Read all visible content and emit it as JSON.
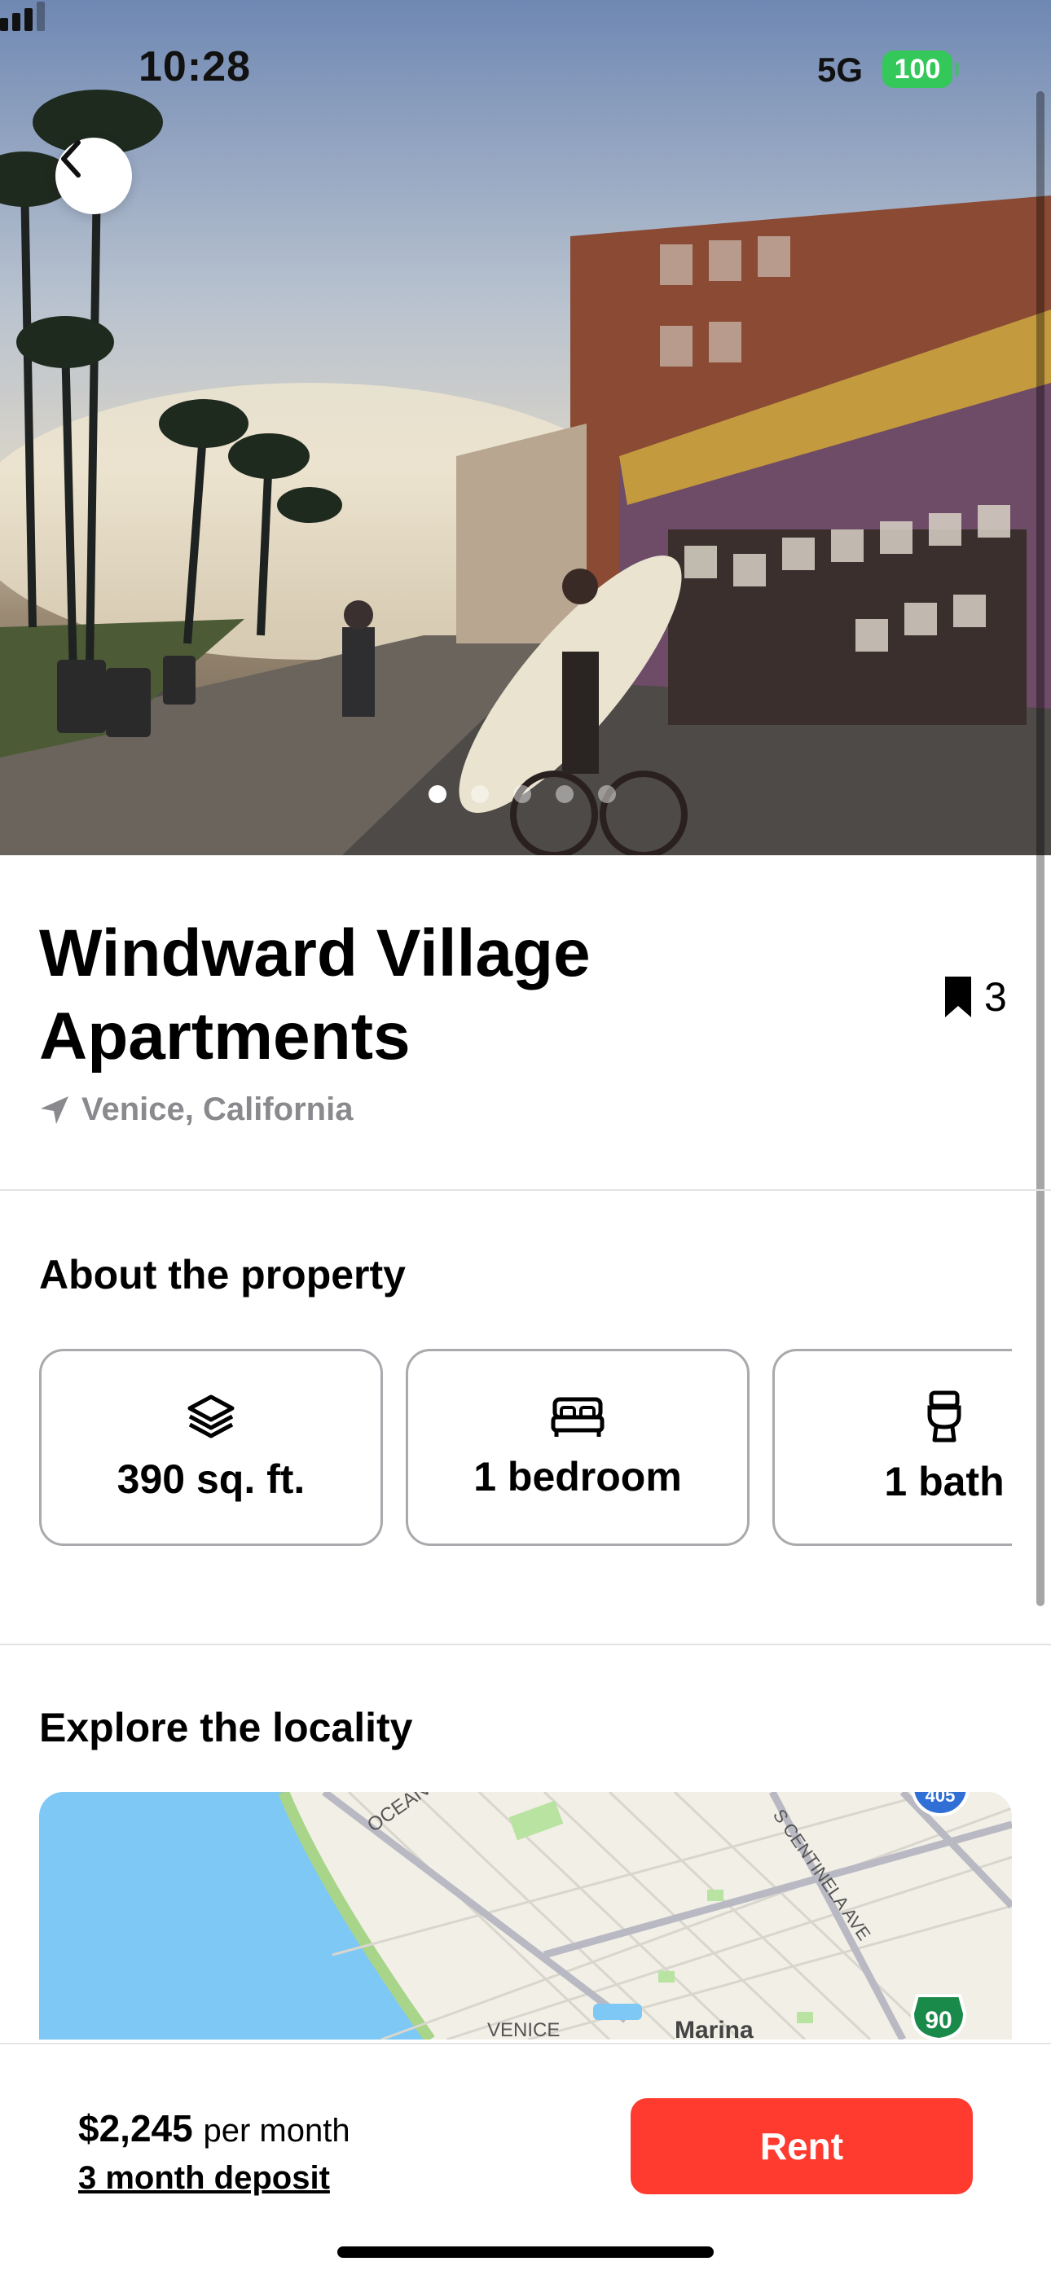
{
  "status_bar": {
    "time": "10:28",
    "network": "5G",
    "battery": "100"
  },
  "gallery": {
    "photo_count": 5,
    "active_index": 0
  },
  "listing": {
    "title": "Windward Village Apartments",
    "location": "Venice, California",
    "saves": "3"
  },
  "about": {
    "heading": "About the property",
    "features": [
      {
        "icon": "layers-icon",
        "label": "390 sq. ft."
      },
      {
        "icon": "bed-icon",
        "label": "1 bedroom"
      },
      {
        "icon": "toilet-icon",
        "label": "1 bath"
      }
    ]
  },
  "locality": {
    "heading": "Explore the locality",
    "map_labels": {
      "street1": "OCEAN",
      "street2": "S CENTINELA AVE",
      "area1": "VENICE",
      "area2": "Marina",
      "shield": "90",
      "shield_top": "405"
    }
  },
  "footer": {
    "price": "$2,245",
    "period": "per month",
    "deposit": "3 month deposit",
    "rent_label": "Rent"
  },
  "colors": {
    "accent": "#ff3b30",
    "battery": "#34c759",
    "muted": "#8a8a8e",
    "water": "#7dc8f5"
  }
}
